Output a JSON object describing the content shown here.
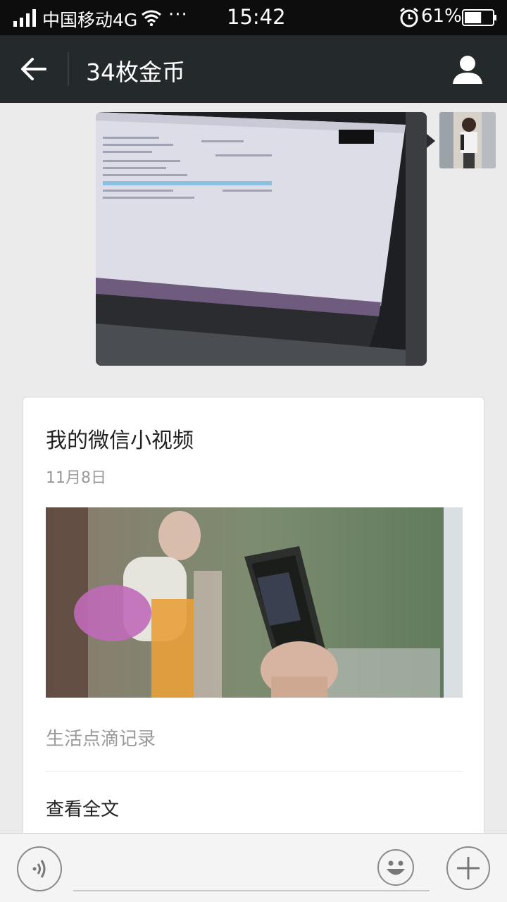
{
  "status_bar": {
    "carrier": "中国移动4G",
    "more": "···",
    "time": "15:42",
    "battery": "61%",
    "battery_level": 0.61,
    "icons": [
      "signal-icon",
      "wifi-icon",
      "alarm-icon",
      "battery-icon"
    ]
  },
  "header": {
    "title": "34枚金币",
    "icons": [
      "back-arrow-icon",
      "person-icon"
    ]
  },
  "messages": {
    "image_message": {
      "description_icon": "photo-thumbnail"
    },
    "article": {
      "title": "我的微信小视频",
      "date": "11月8日",
      "digest": "生活点滴记录",
      "read_more": "查看全文"
    }
  },
  "input_bar": {
    "icons": [
      "voice-icon",
      "emoji-icon",
      "plus-icon"
    ],
    "text_value": ""
  },
  "colors": {
    "status_bar_bg": "#0d0d0d",
    "title_bar_bg": "#242a2c",
    "chat_bg": "#ebebeb",
    "card_bg": "#ffffff",
    "muted_text": "#999999"
  }
}
